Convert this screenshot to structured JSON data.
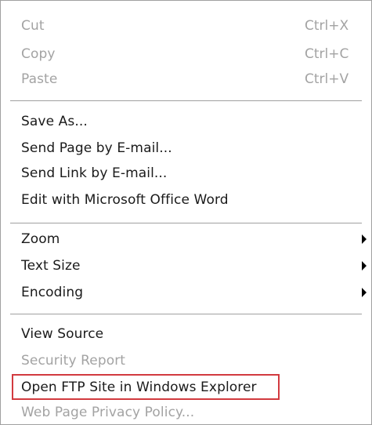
{
  "context_menu": {
    "edit_group": {
      "cut": {
        "label": "Cut",
        "shortcut": "Ctrl+X",
        "enabled": false
      },
      "copy": {
        "label": "Copy",
        "shortcut": "Ctrl+C",
        "enabled": false
      },
      "paste": {
        "label": "Paste",
        "shortcut": "Ctrl+V",
        "enabled": false
      }
    },
    "page_group": {
      "save_as": {
        "label": "Save As...",
        "enabled": true
      },
      "send_page": {
        "label": "Send Page by E-mail...",
        "enabled": true
      },
      "send_link": {
        "label": "Send Link by E-mail...",
        "enabled": true
      },
      "edit_word": {
        "label": "Edit with Microsoft Office Word",
        "enabled": true
      }
    },
    "view_group": {
      "zoom": {
        "label": "Zoom",
        "has_submenu": true
      },
      "text_size": {
        "label": "Text Size",
        "has_submenu": true
      },
      "encoding": {
        "label": "Encoding",
        "has_submenu": true
      }
    },
    "tools_group": {
      "view_source": {
        "label": "View Source",
        "enabled": true
      },
      "security_report": {
        "label": "Security Report",
        "enabled": false
      },
      "open_ftp": {
        "label": "Open FTP Site in Windows Explorer",
        "enabled": true,
        "highlighted": true
      },
      "privacy_policy": {
        "label": "Web Page Privacy Policy...",
        "enabled": false
      }
    }
  },
  "colors": {
    "enabled_text": "#1a1a1a",
    "disabled_text": "#a3a3a3",
    "highlight_border": "#d23a3f",
    "separator": "#a0a0a0"
  },
  "icons": {
    "submenu": "submenu-arrow-icon"
  }
}
